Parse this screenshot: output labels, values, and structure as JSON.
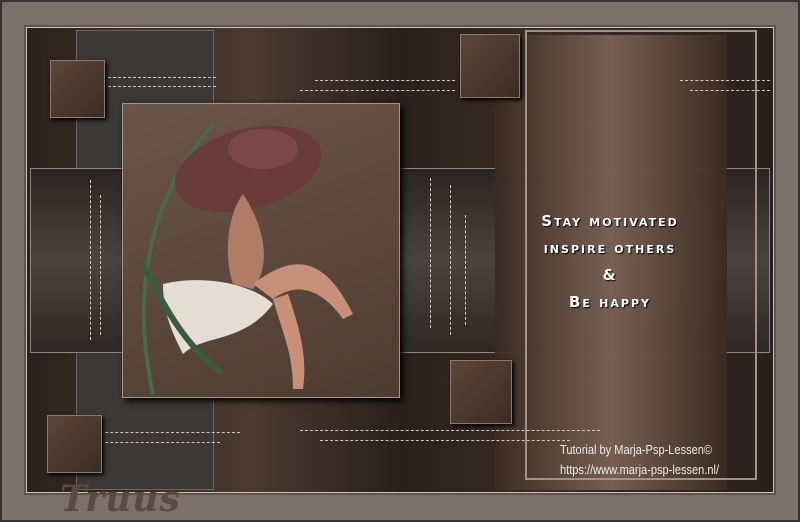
{
  "motto": {
    "line1": "Stay motivated",
    "line2": "inspire others",
    "line3": "&",
    "line4": "Be happy"
  },
  "credit": {
    "line1": "Tutorial by Marja-Psp-Lessen©",
    "line2": "https://www.marja-psp-lessen.nl/"
  },
  "signature": "Truus",
  "colors": {
    "frame": "#7b706a",
    "accent": "#6b5548"
  }
}
